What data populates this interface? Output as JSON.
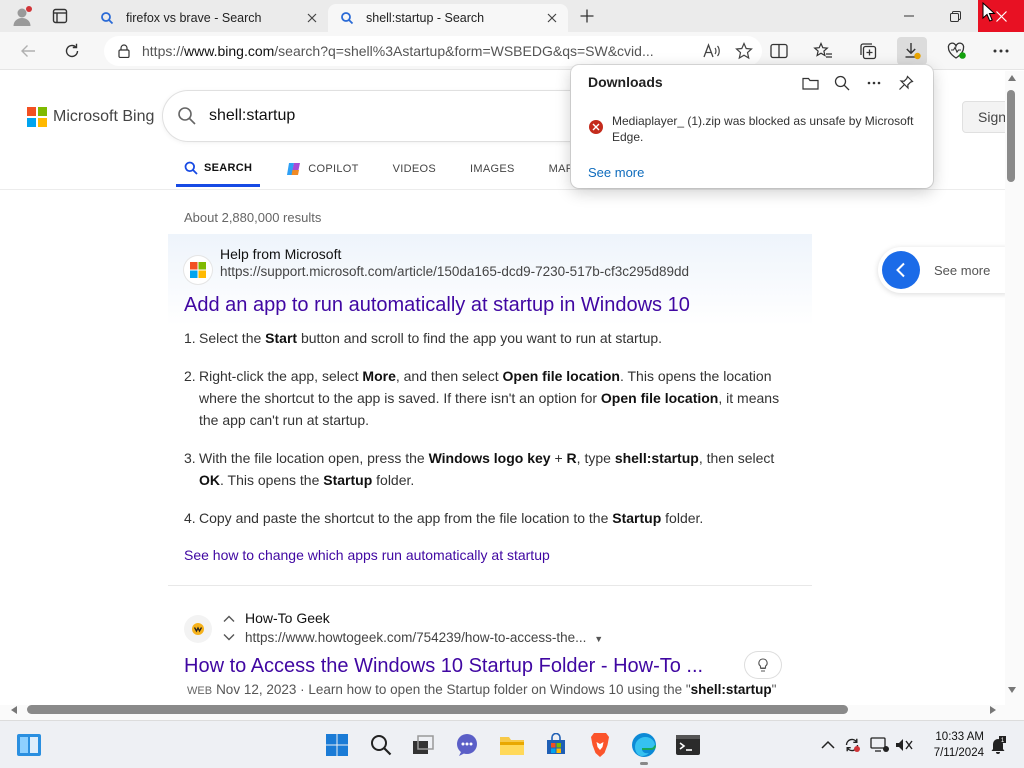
{
  "browser": {
    "tabs": [
      {
        "title": "firefox vs brave - Search",
        "active": false
      },
      {
        "title": "shell:startup - Search",
        "active": true
      }
    ],
    "address_prefix": "https://",
    "address_domain": "www.bing.com",
    "address_rest": "/search?q=shell%3Astartup&form=WSBEDG&qs=SW&cvid..."
  },
  "bing": {
    "logo_text": "Microsoft Bing",
    "query": "shell:startup",
    "sign_in": "Sign",
    "scopes": [
      {
        "label": "SEARCH",
        "active": true
      },
      {
        "label": "COPILOT",
        "active": false
      },
      {
        "label": "VIDEOS",
        "active": false
      },
      {
        "label": "IMAGES",
        "active": false
      },
      {
        "label": "MAPS",
        "active": false
      }
    ],
    "result_count": "About 2,880,000 results",
    "answer": {
      "source_name": "Help from Microsoft",
      "source_url": "https://support.microsoft.com/article/150da165-dcd9-7230-517b-cf3c295d89dd",
      "title": "Add an app to run automatically at startup in Windows 10",
      "steps": [
        {
          "num": "1.",
          "parts": [
            [
              "t",
              "Select the "
            ],
            [
              "b",
              "Start"
            ],
            [
              "t",
              "  button and scroll to find the app you want to run at startup."
            ]
          ]
        },
        {
          "num": "2.",
          "parts": [
            [
              "t",
              "Right-click the app, select "
            ],
            [
              "b",
              "More"
            ],
            [
              "t",
              ", and then select "
            ],
            [
              "b",
              "Open file location"
            ],
            [
              "t",
              ". This opens the location where the shortcut to the app is saved. If there isn't an option for "
            ],
            [
              "b",
              "Open file location"
            ],
            [
              "t",
              ", it means the app can't run at startup."
            ]
          ]
        },
        {
          "num": "3.",
          "parts": [
            [
              "t",
              "With the file location open, press the "
            ],
            [
              "b",
              "Windows logo key"
            ],
            [
              "t",
              " + "
            ],
            [
              "b",
              "R"
            ],
            [
              "t",
              ", type "
            ],
            [
              "b",
              "shell:startup"
            ],
            [
              "t",
              ", then select "
            ],
            [
              "b",
              "OK"
            ],
            [
              "t",
              ". This opens the "
            ],
            [
              "b",
              "Startup"
            ],
            [
              "t",
              " folder."
            ]
          ]
        },
        {
          "num": "4.",
          "parts": [
            [
              "t",
              "Copy and paste the shortcut to the app from the file location to the "
            ],
            [
              "b",
              "Startup"
            ],
            [
              "t",
              " folder."
            ]
          ]
        }
      ],
      "see_how": "See how to change which apps run automatically at startup"
    },
    "result2": {
      "name": "How-To Geek",
      "url": "https://www.howtogeek.com/754239/how-to-access-the...",
      "title": "How to Access the Windows 10 Startup Folder - How-To ...",
      "badge": "WEB",
      "snippet_pre": "Nov 12, 2023 · Learn how to open the Startup folder on Windows 10 using the \"",
      "snippet_bold": "shell:startup",
      "snippet_post": "\""
    },
    "see_more": "See more"
  },
  "downloads": {
    "title": "Downloads",
    "message": "Mediaplayer_ (1).zip was blocked as unsafe by Microsoft Edge.",
    "see_more": "See more"
  },
  "taskbar": {
    "time": "10:33 AM",
    "date": "7/11/2024"
  },
  "colors": {
    "link": "#4007a2",
    "accent": "#174ae4",
    "close": "#e81123",
    "error": "#c42b1c"
  }
}
